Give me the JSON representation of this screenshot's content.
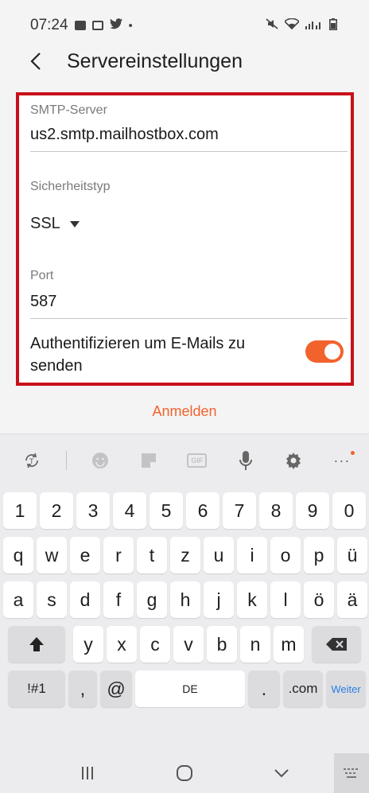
{
  "status_bar": {
    "time": "07:24"
  },
  "header": {
    "title": "Servereinstellungen"
  },
  "form": {
    "smtp_label": "SMTP-Server",
    "smtp_value": "us2.smtp.mailhostbox.com",
    "security_label": "Sicherheitstyp",
    "security_value": "SSL",
    "port_label": "Port",
    "port_value": "587",
    "auth_label": "Authentifizieren um E-Mails zu senden",
    "auth_enabled": true
  },
  "action": {
    "label": "Anmelden"
  },
  "keyboard": {
    "number_row": [
      "1",
      "2",
      "3",
      "4",
      "5",
      "6",
      "7",
      "8",
      "9",
      "0"
    ],
    "row1": [
      "q",
      "w",
      "e",
      "r",
      "t",
      "z",
      "u",
      "i",
      "o",
      "p",
      "ü"
    ],
    "row2": [
      "a",
      "s",
      "d",
      "f",
      "g",
      "h",
      "j",
      "k",
      "l",
      "ö",
      "ä"
    ],
    "row3": [
      "y",
      "x",
      "c",
      "v",
      "b",
      "n",
      "m"
    ],
    "bottom": {
      "symbols": "!#1",
      "comma": ",",
      "at": "@",
      "space": "DE",
      "period": ".",
      "dotcom": ".com",
      "next": "Weiter"
    },
    "toolbar_icons": [
      "translate-icon",
      "emoji-icon",
      "sticker-icon",
      "gif-icon",
      "microphone-icon",
      "gear-icon",
      "more-icon"
    ]
  },
  "colors": {
    "accent": "#f2622d",
    "highlight_border": "#c8101a",
    "link_blue": "#2a7de1"
  }
}
